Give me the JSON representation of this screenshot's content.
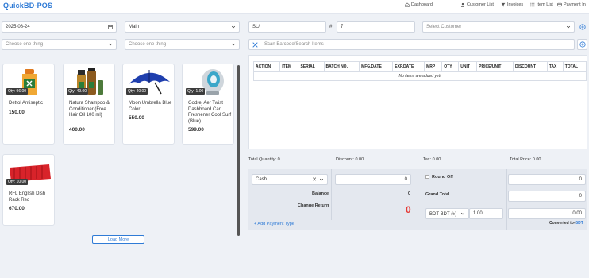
{
  "app": {
    "title": "QuickBD-POS"
  },
  "nav": [
    {
      "label": "Dashboard",
      "icon": "home-icon"
    },
    {
      "label": "Customer List",
      "icon": "user-icon"
    },
    {
      "label": "Invoices",
      "icon": "filter-icon"
    },
    {
      "label": "Item List",
      "icon": "list-icon"
    },
    {
      "label": "Payment In",
      "icon": "payment-icon"
    }
  ],
  "form": {
    "date": "2025-08-24",
    "location": "Main",
    "invoice_prefix": "SL/",
    "hash": "#",
    "invoice_number": "7",
    "customer_placeholder": "Select Customer",
    "filter1_placeholder": "Choose one thing",
    "filter2_placeholder": "Choose one thing",
    "barcode_placeholder": "Scan Barcode/Search Items"
  },
  "products": [
    {
      "name": "Dettol Antiseptic",
      "price": "150.00",
      "qty": "Qty: 96.00"
    },
    {
      "name": "Natura Shampoo & Conditioner (Free Hair Oil 100 ml)",
      "price": "400.00",
      "qty": "Qty: 49.00"
    },
    {
      "name": "Moon Umbrella Blue Color",
      "price": "550.00",
      "qty": "Qty: 40.00"
    },
    {
      "name": "Godrej Aer Twist Dashboard Car Freshener Cool Surf (Blue)",
      "price": "599.00",
      "qty": "Qty: 1.00"
    },
    {
      "name": "RFL English Dish Rack Red",
      "price": "670.00",
      "qty": "Qty: 10.00"
    }
  ],
  "load_more": "Load More",
  "table": {
    "headers": [
      "ACTION",
      "ITEM",
      "SERIAL",
      "BATCH NO.",
      "MFG.DATE",
      "EXP.DATE",
      "MRP",
      "QTY",
      "UNIT",
      "PRICE/UNIT",
      "DISCOUNT",
      "TAX",
      "TOTAL"
    ],
    "empty": "No items are added yet!"
  },
  "summary": {
    "total_quantity": "Total Quantity: 0",
    "discount": "Discount: 0.00",
    "tax": "Tax: 0.00",
    "total_price": "Total Price: 0.00"
  },
  "payment": {
    "method": "Cash",
    "amount": "0",
    "balance_label": "Balance",
    "balance_value": "0",
    "change_label": "Change Return",
    "change_value": "0",
    "add_payment": "+ Add Payment Type",
    "round_off_label": "Round Off",
    "round_off_value": "0",
    "grand_total_label": "Grand Total",
    "grand_total_value": "0",
    "currency": "BDT-BDT (৳)",
    "rate": "1.00",
    "converted_value": "0.00",
    "converted_prefix": "Converted to-",
    "converted_currency": "BDT"
  },
  "colors": {
    "accent": "#2f7bd6",
    "danger": "#e53935"
  }
}
